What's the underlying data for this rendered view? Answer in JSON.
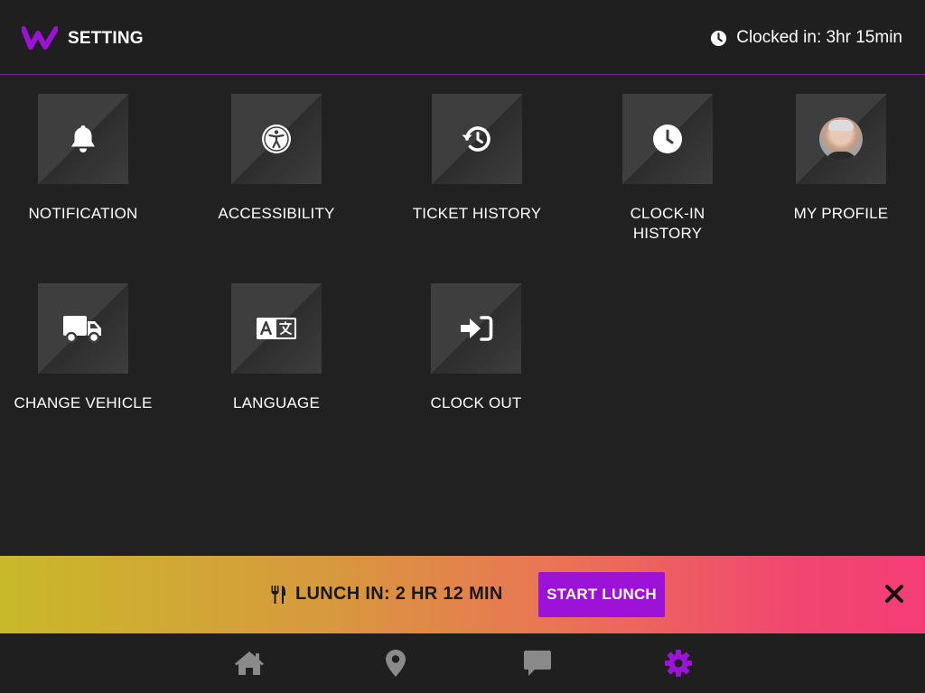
{
  "header": {
    "title": "SETTING",
    "clock_status": "Clocked in: 3hr 15min",
    "logo_icon": "w-logo-icon",
    "clock_icon": "clock-icon"
  },
  "tiles": [
    {
      "label": "NOTIFICATION",
      "icon": "bell-icon"
    },
    {
      "label": "ACCESSIBILITY",
      "icon": "accessibility-icon"
    },
    {
      "label": "TICKET HISTORY",
      "icon": "history-icon"
    },
    {
      "label_line1": "CLOCK-IN",
      "label_line2": "HISTORY",
      "icon": "clock-icon"
    },
    {
      "label": "MY PROFILE",
      "icon": "avatar"
    },
    {
      "label": "CHANGE VEHICLE",
      "icon": "truck-icon"
    },
    {
      "label": "LANGUAGE",
      "icon": "translate-icon"
    },
    {
      "label": "CLOCK OUT",
      "icon": "sign-in-icon"
    }
  ],
  "lunch_banner": {
    "text": "LUNCH IN: 2 HR 12 MIN",
    "button_label": "START LUNCH",
    "icon": "utensils-icon"
  },
  "bottom_nav": [
    {
      "name": "home",
      "icon": "home-icon",
      "active": false
    },
    {
      "name": "map",
      "icon": "map-marker-icon",
      "active": false
    },
    {
      "name": "messages",
      "icon": "chat-icon",
      "active": false
    },
    {
      "name": "settings",
      "icon": "gear-icon",
      "active": true
    }
  ],
  "colors": {
    "background": "#212121",
    "accent": "#9c12d6",
    "tile": "#3e3e3e",
    "nav_inactive": "#8a8a8a",
    "nav_active": "#9c12d6"
  }
}
